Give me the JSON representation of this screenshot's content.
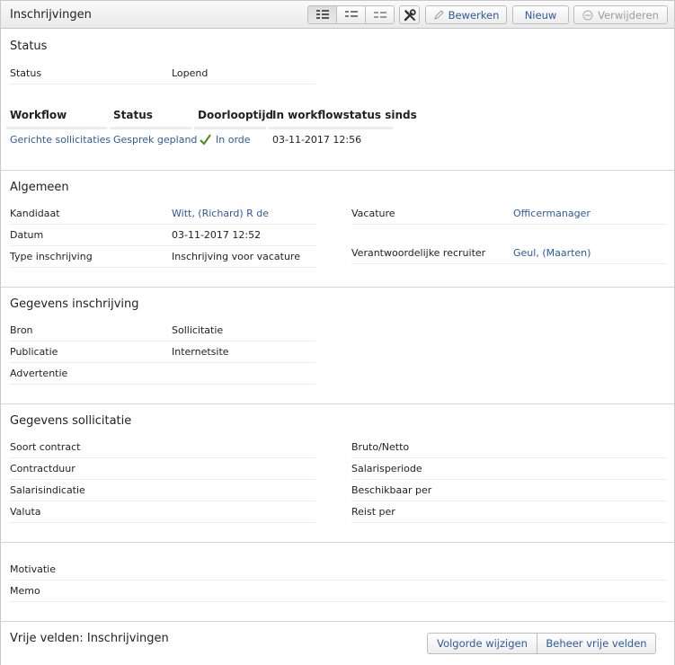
{
  "header": {
    "title": "Inschrijvingen",
    "edit_label": "Bewerken",
    "new_label": "Nieuw",
    "delete_label": "Verwijderen"
  },
  "status_section": {
    "title": "Status",
    "status_key": "Status",
    "status_value": "Lopend",
    "workflow_headers": [
      "Workflow",
      "Status",
      "Doorlooptijd",
      "In workflowstatus sinds"
    ],
    "workflow_row": {
      "workflow": "Gerichte sollicitaties",
      "status": "Gesprek gepland",
      "doorlooptijd": "In orde",
      "sinds": "03-11-2017 12:56"
    }
  },
  "algemeen": {
    "title": "Algemeen",
    "left": [
      {
        "key": "Kandidaat",
        "value": "Witt, (Richard) R de"
      },
      {
        "key": "Datum",
        "value": "03-11-2017 12:52"
      },
      {
        "key": "Type inschrijving",
        "value": "Inschrijving voor vacature"
      }
    ],
    "right": [
      {
        "key": "Vacature",
        "value": "Officermanager"
      },
      {
        "key": "Verantwoordelijke recruiter",
        "value": "Geul, (Maarten)"
      }
    ]
  },
  "gegevens_inschrijving": {
    "title": "Gegevens inschrijving",
    "rows": [
      {
        "key": "Bron",
        "value": "Sollicitatie"
      },
      {
        "key": "Publicatie",
        "value": "Internetsite"
      },
      {
        "key": "Advertentie",
        "value": ""
      }
    ]
  },
  "gegevens_sollicitatie": {
    "title": "Gegevens sollicitatie",
    "left": [
      "Soort contract",
      "Contractduur",
      "Salarisindicatie",
      "Valuta"
    ],
    "right": [
      "Bruto/Netto",
      "Salarisperiode",
      "Beschikbaar per",
      "Reist per"
    ]
  },
  "notes": {
    "rows": [
      "Motivatie",
      "Memo"
    ]
  },
  "vrije_velden": {
    "title": "Vrije velden: Inschrijvingen",
    "order_label": "Volgorde wijzigen",
    "manage_label": "Beheer vrije velden"
  },
  "colors": {
    "link": "#2c5aa0",
    "check": "#4a8a1c"
  }
}
